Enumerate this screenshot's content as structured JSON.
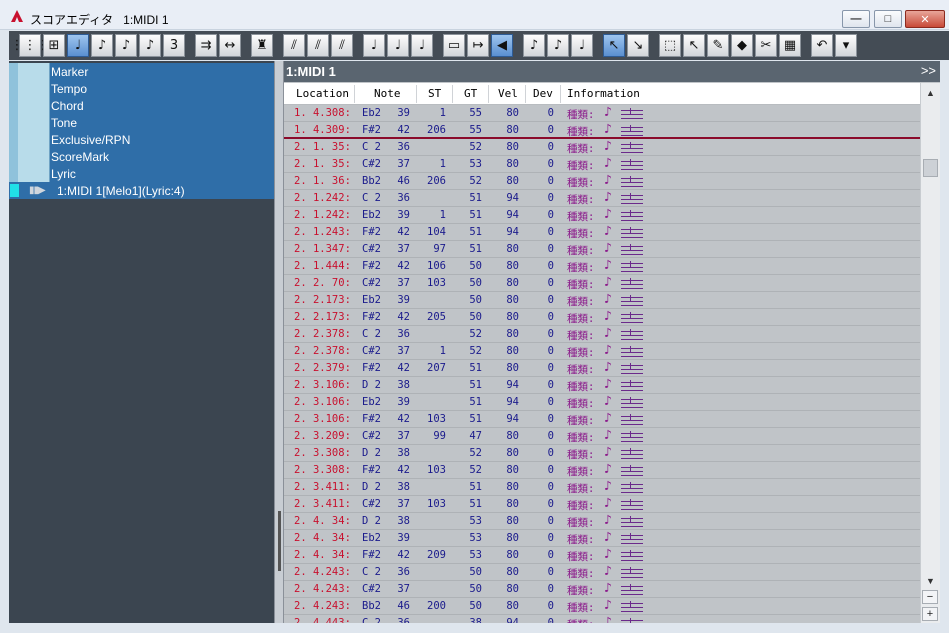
{
  "window": {
    "title": "スコアエディタ   1:MIDI 1",
    "minimize": "—",
    "maximize": "□",
    "close": "✕"
  },
  "toolbar": {
    "icons": [
      "grid-icon",
      "grid-alt-icon",
      "quarter-note-icon",
      "eighth-note-icon",
      "sixteenth-note-icon",
      "thirtysecond-note-icon",
      "triplet-icon",
      "",
      "repeat-icon",
      "stretch-icon",
      "",
      "metronome-icon",
      "",
      "rest-icon",
      "double-rest-icon",
      "triple-rest-icon",
      "",
      "tie-icon",
      "slur-icon",
      "accent-icon",
      "",
      "rect-icon",
      "arrow-right-icon",
      "speaker-icon",
      "",
      "dynamics-i-icon",
      "dynamics-p-icon",
      "note-box-icon",
      "",
      "pointer-icon",
      "pencil-icon",
      "",
      "select-rect-icon",
      "select-point-icon",
      "eraser-icon",
      "paint-icon",
      "speaker-cut-icon",
      "piano-icon",
      "",
      "undo-icon",
      "more-icon"
    ],
    "glyphs": [
      "⋮⋮⋮",
      "⊞",
      "♩",
      "♪",
      "♪",
      "♪",
      "3",
      "",
      "⇉",
      "↔",
      "",
      "♜",
      "",
      "⫽",
      "⫽",
      "⫽",
      "",
      "♩",
      "♩",
      "♩",
      "",
      "▭",
      "↦",
      "◀",
      "",
      "♪",
      "♪",
      "♩",
      "",
      "↖",
      "↘",
      "",
      "⬚",
      "↖",
      "✎",
      "◆",
      "✂",
      "▦",
      "",
      "↶",
      "▾"
    ]
  },
  "tracks": {
    "items": [
      {
        "label": "Marker"
      },
      {
        "label": "Tempo"
      },
      {
        "label": "Chord"
      },
      {
        "label": "Tone"
      },
      {
        "label": "Exclusive/RPN"
      },
      {
        "label": "ScoreMark"
      },
      {
        "label": "Lyric"
      }
    ],
    "midi": {
      "label": "1:MIDI 1[Melo1](Lyric:4)",
      "play_glyph": "▮▮▶"
    }
  },
  "panel": {
    "title": "1:MIDI 1",
    "more": ">>"
  },
  "columns": {
    "location": "Location",
    "note": "Note",
    "st": "ST",
    "gt": "GT",
    "vel": "Vel",
    "dev": "Dev",
    "info": "Information"
  },
  "info_label": "種類:",
  "events": [
    {
      "loc": "1. 4.308:",
      "note": "Eb2",
      "num": "39",
      "st": "1",
      "gt": "55",
      "vel": "80",
      "dev": "0"
    },
    {
      "loc": "1. 4.309:",
      "note": "F#2",
      "num": "42",
      "st": "206",
      "gt": "55",
      "vel": "80",
      "dev": "0"
    },
    {
      "loc": "2. 1. 35:",
      "note": "C 2",
      "num": "36",
      "st": "",
      "gt": "52",
      "vel": "80",
      "dev": "0"
    },
    {
      "loc": "2. 1. 35:",
      "note": "C#2",
      "num": "37",
      "st": "1",
      "gt": "53",
      "vel": "80",
      "dev": "0"
    },
    {
      "loc": "2. 1. 36:",
      "note": "Bb2",
      "num": "46",
      "st": "206",
      "gt": "52",
      "vel": "80",
      "dev": "0"
    },
    {
      "loc": "2. 1.242:",
      "note": "C 2",
      "num": "36",
      "st": "",
      "gt": "51",
      "vel": "94",
      "dev": "0"
    },
    {
      "loc": "2. 1.242:",
      "note": "Eb2",
      "num": "39",
      "st": "1",
      "gt": "51",
      "vel": "94",
      "dev": "0"
    },
    {
      "loc": "2. 1.243:",
      "note": "F#2",
      "num": "42",
      "st": "104",
      "gt": "51",
      "vel": "94",
      "dev": "0"
    },
    {
      "loc": "2. 1.347:",
      "note": "C#2",
      "num": "37",
      "st": "97",
      "gt": "51",
      "vel": "80",
      "dev": "0"
    },
    {
      "loc": "2. 1.444:",
      "note": "F#2",
      "num": "42",
      "st": "106",
      "gt": "50",
      "vel": "80",
      "dev": "0"
    },
    {
      "loc": "2. 2. 70:",
      "note": "C#2",
      "num": "37",
      "st": "103",
      "gt": "50",
      "vel": "80",
      "dev": "0"
    },
    {
      "loc": "2. 2.173:",
      "note": "Eb2",
      "num": "39",
      "st": "",
      "gt": "50",
      "vel": "80",
      "dev": "0"
    },
    {
      "loc": "2. 2.173:",
      "note": "F#2",
      "num": "42",
      "st": "205",
      "gt": "50",
      "vel": "80",
      "dev": "0"
    },
    {
      "loc": "2. 2.378:",
      "note": "C 2",
      "num": "36",
      "st": "",
      "gt": "52",
      "vel": "80",
      "dev": "0"
    },
    {
      "loc": "2. 2.378:",
      "note": "C#2",
      "num": "37",
      "st": "1",
      "gt": "52",
      "vel": "80",
      "dev": "0"
    },
    {
      "loc": "2. 2.379:",
      "note": "F#2",
      "num": "42",
      "st": "207",
      "gt": "51",
      "vel": "80",
      "dev": "0"
    },
    {
      "loc": "2. 3.106:",
      "note": "D 2",
      "num": "38",
      "st": "",
      "gt": "51",
      "vel": "94",
      "dev": "0"
    },
    {
      "loc": "2. 3.106:",
      "note": "Eb2",
      "num": "39",
      "st": "",
      "gt": "51",
      "vel": "94",
      "dev": "0"
    },
    {
      "loc": "2. 3.106:",
      "note": "F#2",
      "num": "42",
      "st": "103",
      "gt": "51",
      "vel": "94",
      "dev": "0"
    },
    {
      "loc": "2. 3.209:",
      "note": "C#2",
      "num": "37",
      "st": "99",
      "gt": "47",
      "vel": "80",
      "dev": "0"
    },
    {
      "loc": "2. 3.308:",
      "note": "D 2",
      "num": "38",
      "st": "",
      "gt": "52",
      "vel": "80",
      "dev": "0"
    },
    {
      "loc": "2. 3.308:",
      "note": "F#2",
      "num": "42",
      "st": "103",
      "gt": "52",
      "vel": "80",
      "dev": "0"
    },
    {
      "loc": "2. 3.411:",
      "note": "D 2",
      "num": "38",
      "st": "",
      "gt": "51",
      "vel": "80",
      "dev": "0"
    },
    {
      "loc": "2. 3.411:",
      "note": "C#2",
      "num": "37",
      "st": "103",
      "gt": "51",
      "vel": "80",
      "dev": "0"
    },
    {
      "loc": "2. 4. 34:",
      "note": "D 2",
      "num": "38",
      "st": "",
      "gt": "53",
      "vel": "80",
      "dev": "0"
    },
    {
      "loc": "2. 4. 34:",
      "note": "Eb2",
      "num": "39",
      "st": "",
      "gt": "53",
      "vel": "80",
      "dev": "0"
    },
    {
      "loc": "2. 4. 34:",
      "note": "F#2",
      "num": "42",
      "st": "209",
      "gt": "53",
      "vel": "80",
      "dev": "0"
    },
    {
      "loc": "2. 4.243:",
      "note": "C 2",
      "num": "36",
      "st": "",
      "gt": "50",
      "vel": "80",
      "dev": "0"
    },
    {
      "loc": "2. 4.243:",
      "note": "C#2",
      "num": "37",
      "st": "",
      "gt": "50",
      "vel": "80",
      "dev": "0"
    },
    {
      "loc": "2. 4.243:",
      "note": "Bb2",
      "num": "46",
      "st": "200",
      "gt": "50",
      "vel": "80",
      "dev": "0"
    },
    {
      "loc": "2. 4.443:",
      "note": "C 2",
      "num": "36",
      "st": "",
      "gt": "38",
      "vel": "94",
      "dev": "0"
    }
  ],
  "scrollbar": {
    "up": "▲",
    "down": "▼",
    "zoom_out": "−",
    "zoom_in": "+"
  },
  "colors": {
    "location": "#c8102e",
    "values": "#1a1a8c",
    "info": "#8b1a8b",
    "track_bg": "#2f6ea8"
  }
}
